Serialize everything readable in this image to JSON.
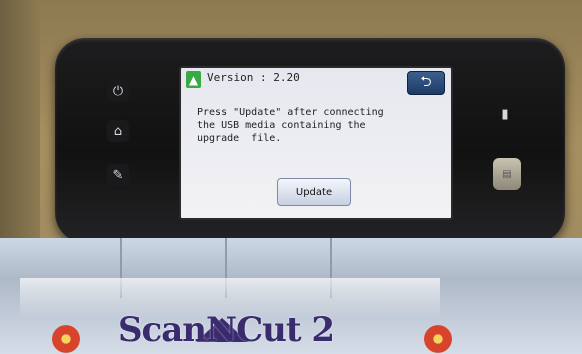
{
  "screen": {
    "version_text": "Version : 2.20",
    "message_lines": [
      "Press \"Update\" after connecting",
      "the USB media containing the",
      "upgrade  file."
    ],
    "update_label": "Update",
    "back_icon": "back-arrow-icon",
    "update_icon": "up-arrow-icon"
  },
  "hardware": {
    "left_buttons": [
      "power-icon",
      "home-icon",
      "wrench-icon"
    ],
    "right_buttons": [
      "card-slot-icon",
      "scan-button"
    ]
  },
  "branding": {
    "text": "ScanNCut 2"
  }
}
